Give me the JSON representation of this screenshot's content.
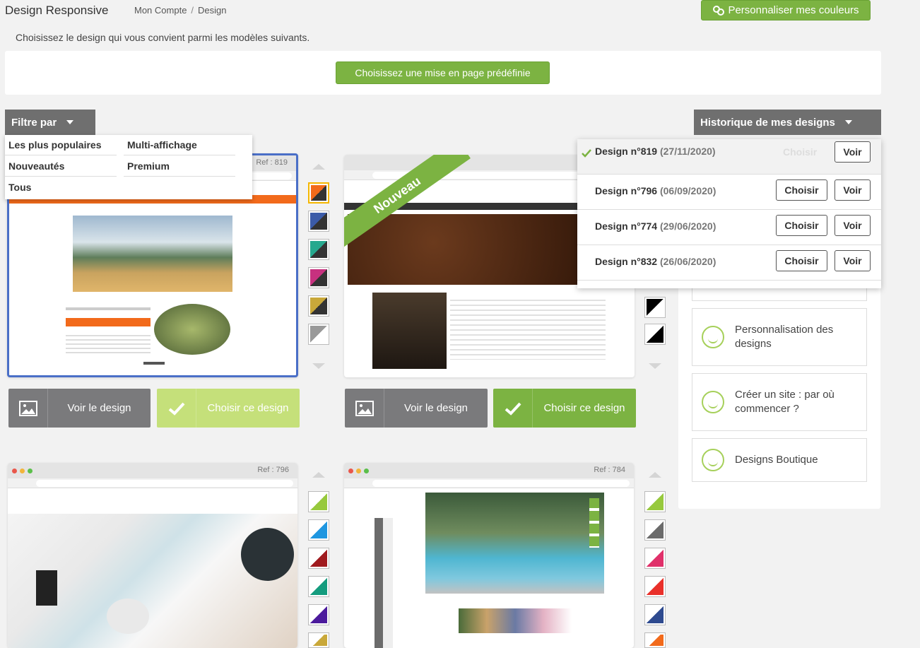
{
  "header": {
    "title": "Design Responsive",
    "breadcrumb": [
      "Mon Compte",
      "Design"
    ],
    "colors_button": "Personnaliser mes couleurs"
  },
  "intro": "Choisissez le design qui vous convient parmi les modèles suivants.",
  "predefined_button": "Choisissez une mise en page prédéfinie",
  "filter": {
    "label": "Filtre par",
    "items": [
      "Les plus populaires",
      "Multi-affichage",
      "Nouveautés",
      "Premium",
      "Tous"
    ]
  },
  "history": {
    "label": "Historique de mes designs",
    "rows": [
      {
        "name": "Design n°819",
        "date": "(27/11/2020)",
        "choose": "Choisir",
        "view": "Voir",
        "current": true
      },
      {
        "name": "Design n°796",
        "date": "(06/09/2020)",
        "choose": "Choisir",
        "view": "Voir",
        "current": false
      },
      {
        "name": "Design n°774",
        "date": "(29/06/2020)",
        "choose": "Choisir",
        "view": "Voir",
        "current": false
      },
      {
        "name": "Design n°832",
        "date": "(26/06/2020)",
        "choose": "Choisir",
        "view": "Voir",
        "current": false
      }
    ]
  },
  "sidebar": {
    "items": [
      "Personnalisation des designs",
      "Créer un site : par où commencer ?",
      "Designs Boutique"
    ]
  },
  "designs": [
    {
      "ref": "Ref : 819",
      "view_label": "Voir le design",
      "choose_label": "Choisir ce design",
      "selected": true
    },
    {
      "ref": "",
      "badge": "Nouveau",
      "view_label": "Voir le design",
      "choose_label": "Choisir ce design",
      "selected": false
    },
    {
      "ref": "Ref : 796"
    },
    {
      "ref": "Ref : 784"
    }
  ],
  "colors": {
    "green": "#7cb342",
    "green_light": "#c5e07a",
    "gray_button": "#7a7a7c",
    "header_gray": "#6f6f6f",
    "selected_border": "#4a6fc7"
  }
}
